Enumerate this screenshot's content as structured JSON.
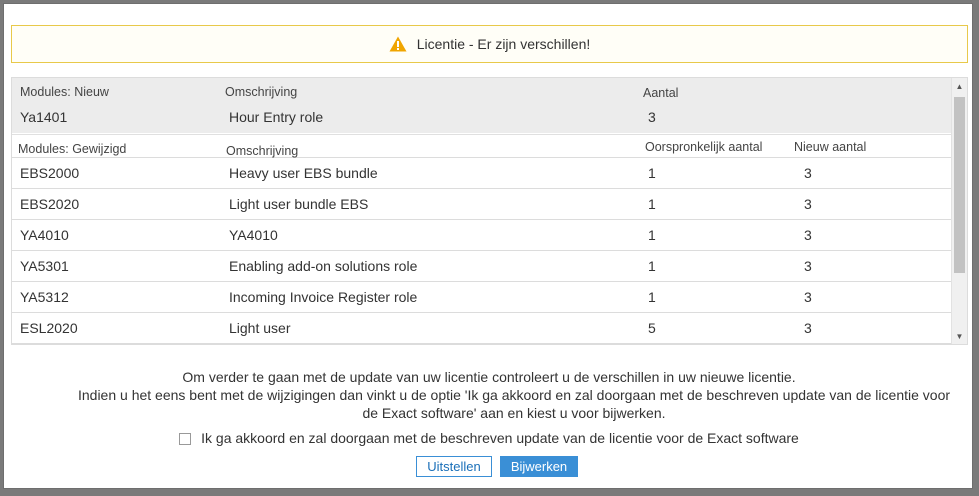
{
  "warning": {
    "icon": "warning-triangle-icon",
    "text": "Licentie - Er zijn verschillen!",
    "colors": {
      "border": "#e8c94a",
      "icon": "#f0a500"
    }
  },
  "new_modules": {
    "headers": [
      "Modules: Nieuw",
      "Omschrijving",
      "Aantal"
    ],
    "rows": [
      {
        "code": "Ya1401",
        "description": "Hour Entry role",
        "quantity": "3"
      }
    ]
  },
  "changed_modules": {
    "headers": [
      "Modules: Gewijzigd",
      "Omschrijving",
      "Oorspronkelijk aantal",
      "Nieuw aantal"
    ],
    "rows": [
      {
        "code": "EBS2000",
        "description": "Heavy user EBS bundle",
        "original": "1",
        "new": "3"
      },
      {
        "code": "EBS2020",
        "description": "Light user bundle EBS",
        "original": "1",
        "new": "3"
      },
      {
        "code": "YA4010",
        "description": "YA4010",
        "original": "1",
        "new": "3"
      },
      {
        "code": "YA5301",
        "description": "Enabling add-on solutions role",
        "original": "1",
        "new": "3"
      },
      {
        "code": "YA5312",
        "description": "Incoming Invoice Register role",
        "original": "1",
        "new": "3"
      },
      {
        "code": "ESL2020",
        "description": "Light user",
        "original": "5",
        "new": "3"
      }
    ]
  },
  "info": {
    "line1": "Om verder te gaan met de update van uw licentie controleert u de verschillen in uw nieuwe licentie.",
    "line2": "Indien u het eens bent met de wijzigingen dan vinkt u de optie 'Ik ga akkoord en zal doorgaan met de beschreven update van de licentie voor de Exact software' aan en kiest u voor bijwerken."
  },
  "agreement": {
    "label": "Ik ga akkoord en zal doorgaan met de beschreven update van de licentie voor de Exact software",
    "checked": false
  },
  "buttons": {
    "postpone": "Uitstellen",
    "update": "Bijwerken",
    "accent": "#3a8fd6"
  },
  "scrollbar": {
    "up": "▲",
    "down": "▼"
  }
}
